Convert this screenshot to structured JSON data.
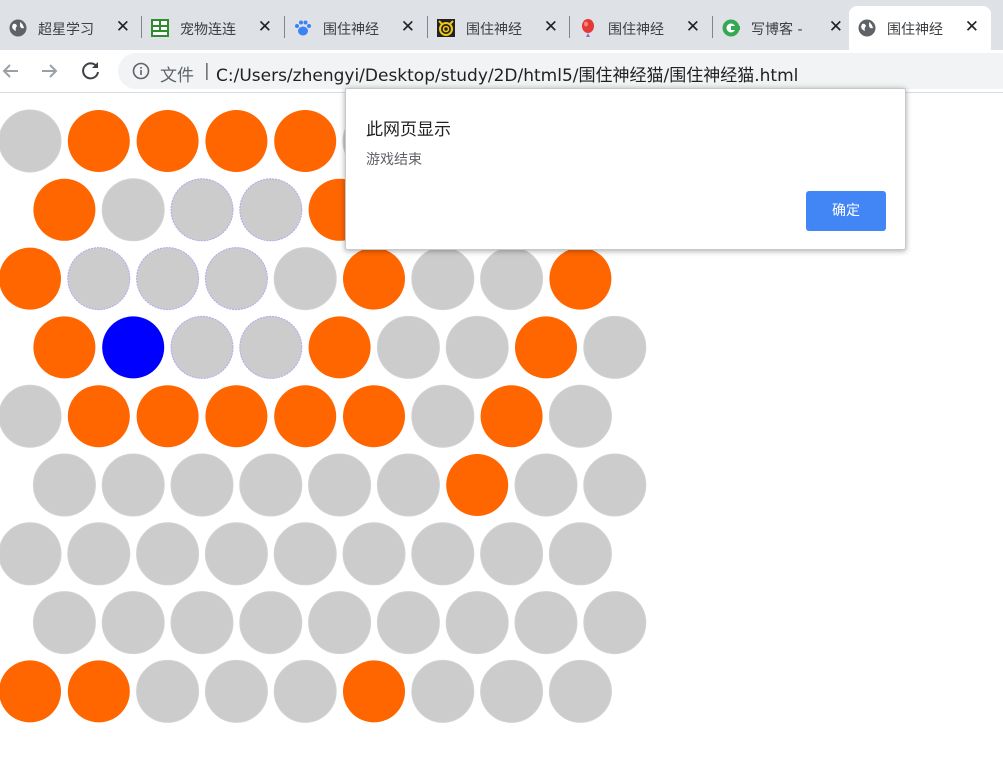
{
  "tabs": [
    {
      "title": "超星学习",
      "close": "✕",
      "favicon": "globe-icon"
    },
    {
      "title": "宠物连连",
      "close": "✕",
      "favicon": "grid-game-icon"
    },
    {
      "title": "围住神经",
      "close": "✕",
      "favicon": "paw-icon"
    },
    {
      "title": "围住神经",
      "close": "✕",
      "favicon": "spiral-cat-icon"
    },
    {
      "title": "围住神经",
      "close": "✕",
      "favicon": "balloon-icon"
    },
    {
      "title": "写博客 -",
      "close": "✕",
      "favicon": "csdn-logo-icon"
    },
    {
      "title": "围住神经",
      "close": "✕",
      "favicon": "globe-icon"
    }
  ],
  "omnibox": {
    "scheme": "文件",
    "divider": "|",
    "url": "C:/Users/zhengyi/Desktop/study/2D/html5/围住神经猫/围住神经猫.html"
  },
  "dialog": {
    "title": "此网页显示",
    "message": "游戏结束",
    "ok_label": "确定"
  },
  "board": {
    "legend": {
      "G": "empty",
      "O": "blocked",
      "L": "empty-visited",
      "B": "cat"
    },
    "colors": {
      "empty": "#cccccc",
      "blocked": "#ff6600",
      "cat": "#0000ff",
      "visited_outline": "#b3a7f0"
    },
    "rows": [
      "GOOOOGGGG",
      "OGLLOGGGG",
      "OLLLGOGGO",
      "OBLLOGGOG",
      "GOOOOOGOG",
      "GGGGGGOGG",
      "GGGGGGGGG",
      "GGGGGGGGG",
      "OOGGGOGGG"
    ]
  }
}
